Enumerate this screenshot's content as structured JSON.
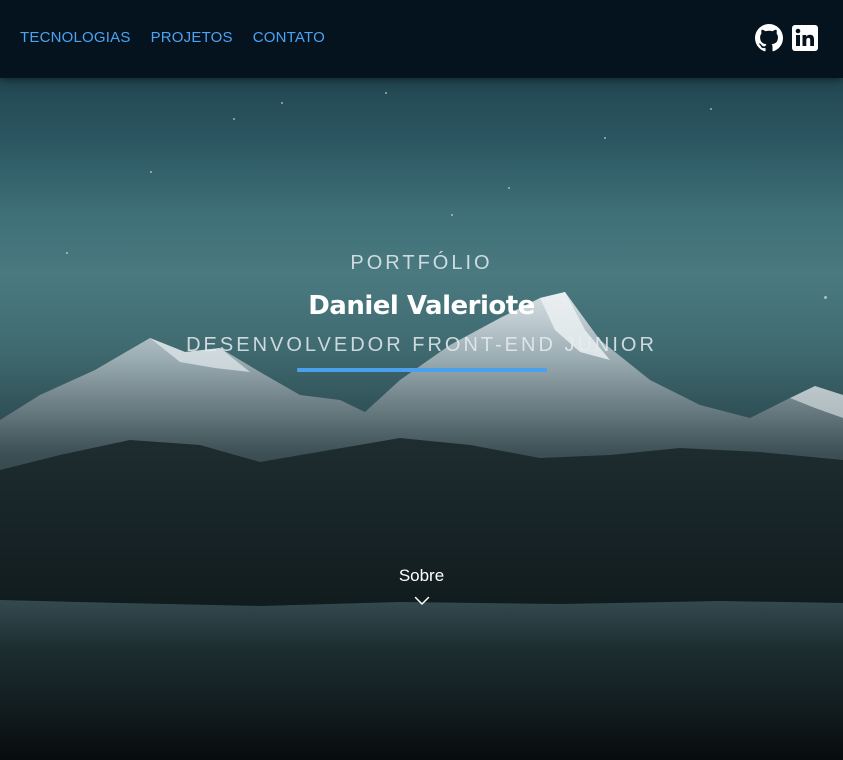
{
  "nav": {
    "links": [
      {
        "label": "TECNOLOGIAS"
      },
      {
        "label": "PROJETOS"
      },
      {
        "label": "CONTATO"
      }
    ],
    "social": [
      {
        "icon": "github-icon"
      },
      {
        "icon": "linkedin-icon"
      }
    ],
    "link_color": "#4da3f2",
    "background": "#05131f"
  },
  "hero": {
    "eyebrow": "PORTFÓLIO",
    "name": "Daniel Valeriote",
    "role": "DESENVOLVEDOR FRONT-END JÚNIOR",
    "accent_color": "#4aa0ec",
    "cta_label": "Sobre",
    "cta_icon": "chevron-down-icon"
  }
}
